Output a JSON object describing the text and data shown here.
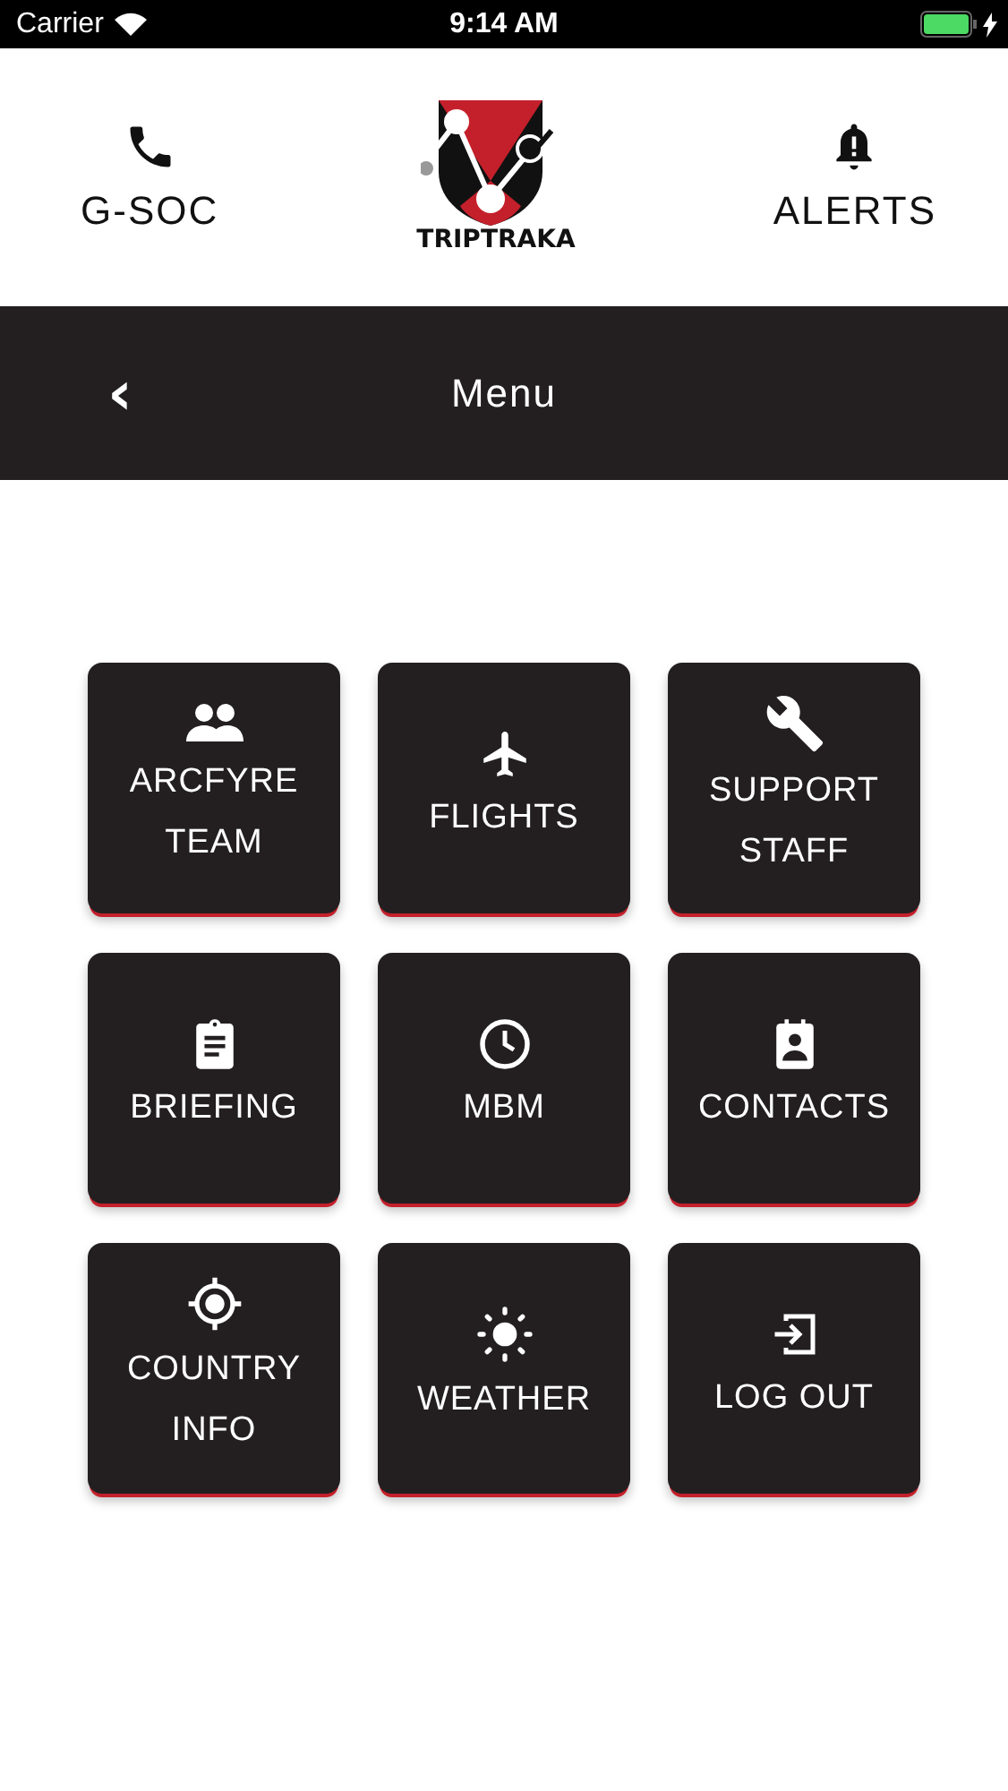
{
  "status_bar": {
    "carrier": "Carrier",
    "time": "9:14 AM"
  },
  "header": {
    "left": {
      "label": "G-SOC"
    },
    "logo": {
      "text": "TRIPTRAKA"
    },
    "right": {
      "label": "ALERTS"
    }
  },
  "nav_bar": {
    "back": "‹",
    "title": "Menu"
  },
  "tiles": [
    {
      "label": "ARCFYRE TEAM"
    },
    {
      "label": "FLIGHTS"
    },
    {
      "label": "SUPPORT STAFF"
    },
    {
      "label": "BRIEFING"
    },
    {
      "label": "MBM"
    },
    {
      "label": "CONTACTS"
    },
    {
      "label": "COUNTRY INFO"
    },
    {
      "label": "WEATHER"
    },
    {
      "label": "LOG OUT"
    }
  ]
}
